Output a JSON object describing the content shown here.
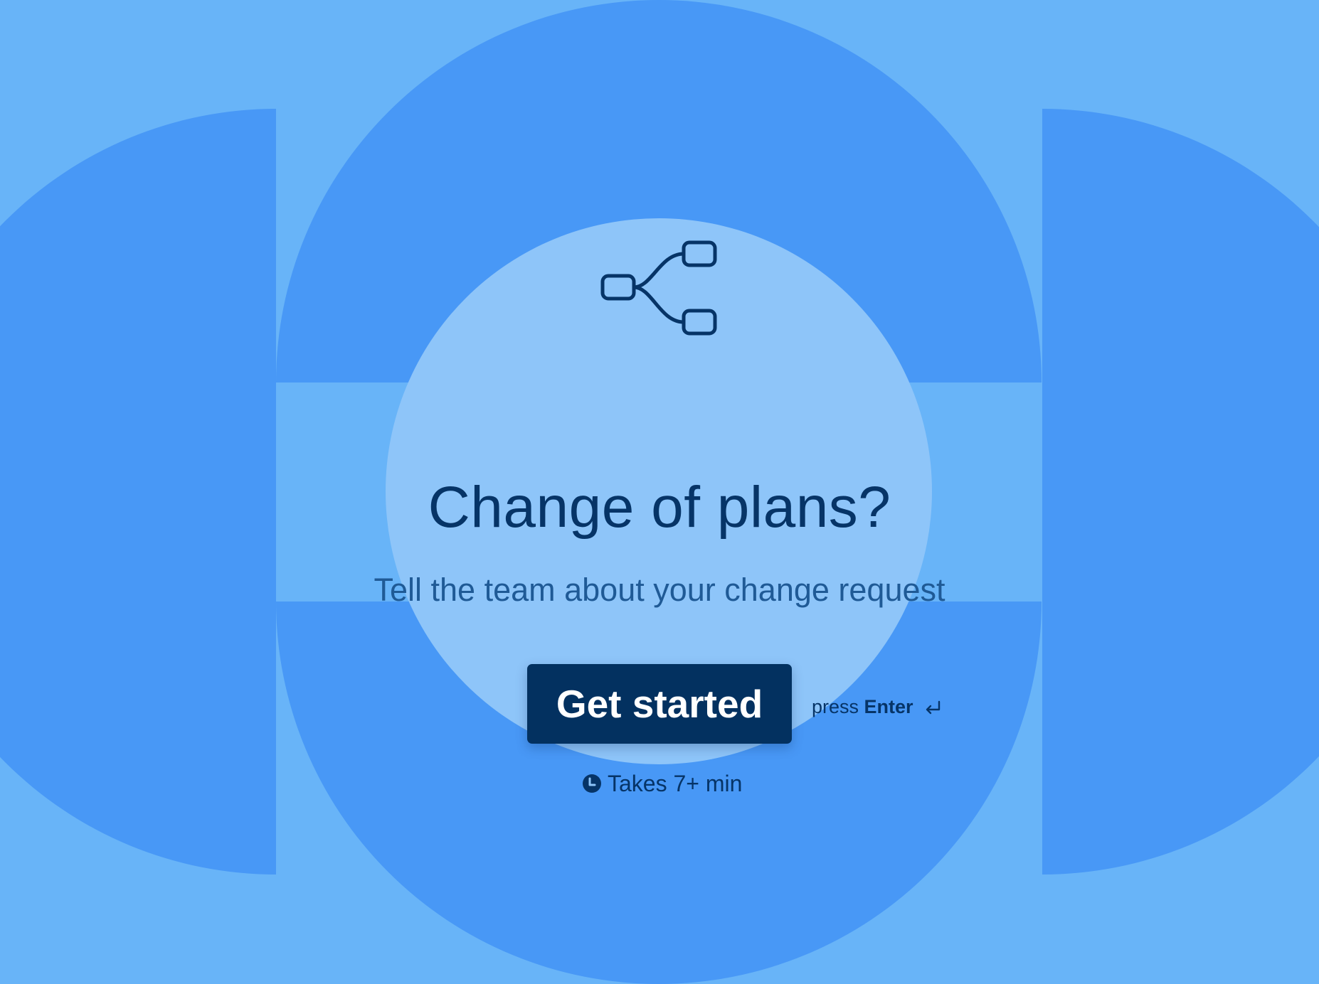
{
  "colors": {
    "background": "#68B4F8",
    "shape_primary": "#4898F6",
    "shape_center_circle": "#8EC5F9",
    "text_primary": "#063467",
    "text_secondary": "#1F5A96",
    "button_bg": "#033160",
    "button_text": "#FFFFFF"
  },
  "icon": {
    "name": "flowchart-branch-icon"
  },
  "welcome": {
    "title": "Change of plans?",
    "subtitle": "Tell the team about your change request",
    "button_label": "Get started",
    "hint_prefix": "press",
    "hint_key": "Enter",
    "hint_icon": "return-icon",
    "duration_icon": "clock-icon",
    "duration_text": "Takes 7+ min"
  }
}
